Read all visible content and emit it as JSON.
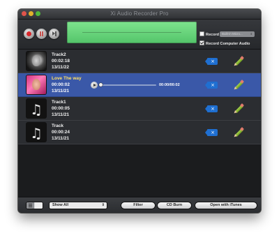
{
  "window": {
    "title": "Xi Audio Recorder Pro"
  },
  "toolbar": {
    "record_option_label": "Record",
    "record_source_value": "Built-in Micro...",
    "record_computer_audio_label": "Record Computer Audio",
    "record_checked": false,
    "record_computer_audio_checked": true
  },
  "tracks": [
    {
      "name": "Track2",
      "duration": "00:02:18",
      "date": "13/11/22",
      "thumb": "photo-dark",
      "selected": false
    },
    {
      "name": "Love The way",
      "duration": "00:00:02",
      "date": "13/11/21",
      "thumb": "photo-pink",
      "selected": true
    },
    {
      "name": "Track1",
      "duration": "00:00:05",
      "date": "13/11/21",
      "thumb": "music",
      "selected": false
    },
    {
      "name": "Track",
      "duration": "00:00:24",
      "date": "13/11/21",
      "thumb": "music",
      "selected": false
    }
  ],
  "player": {
    "time": "00:00/00:02",
    "progress": 0.0
  },
  "bottom": {
    "filter_value": "Show All",
    "filter_button": "Filter",
    "cd_burn_button": "CD Burn",
    "itunes_button": "Open with iTunes"
  },
  "colors": {
    "selected_row": "#3a58a8",
    "selected_name": "#ffe066",
    "meter_green": "#6ad27d",
    "record_red": "#d8272b",
    "badge_blue": "#1f6fd1"
  },
  "icons": {
    "record": "record-icon",
    "pause": "pause-icon",
    "next": "skip-next-icon",
    "delete": "delete-tag-icon",
    "edit": "pencil-icon",
    "music": "music-note-icon"
  }
}
